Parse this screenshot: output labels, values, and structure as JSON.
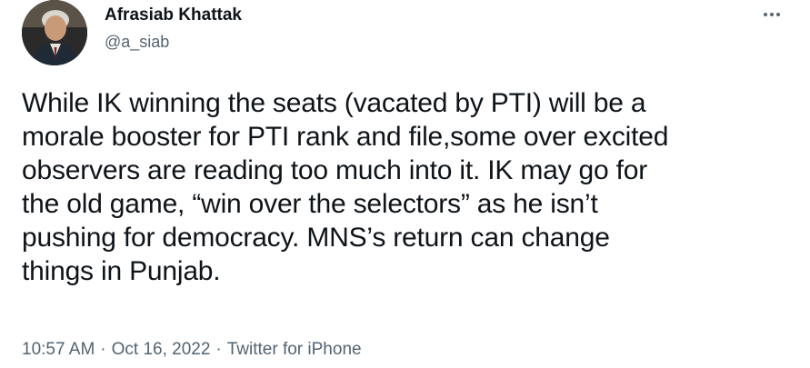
{
  "author": {
    "name": "Afrasiab Khattak",
    "handle": "@a_siab"
  },
  "tweet": {
    "text": "While IK winning the seats (vacated by PTI)  will be a\nmorale booster for PTI rank and file,some over excited\nobservers  are reading too much into it. IK may go for\nthe old game, “win over the selectors” as he isn’t\npushing for democracy. MNS’s return can change\nthings in Punjab."
  },
  "meta": {
    "time": "10:57 AM",
    "date": "Oct 16, 2022",
    "source": "Twitter for iPhone",
    "separator": "·"
  },
  "icons": {
    "more": "more-options-icon",
    "avatar": "profile-photo"
  },
  "colors": {
    "text": "#0f1419",
    "secondary": "#536471"
  }
}
